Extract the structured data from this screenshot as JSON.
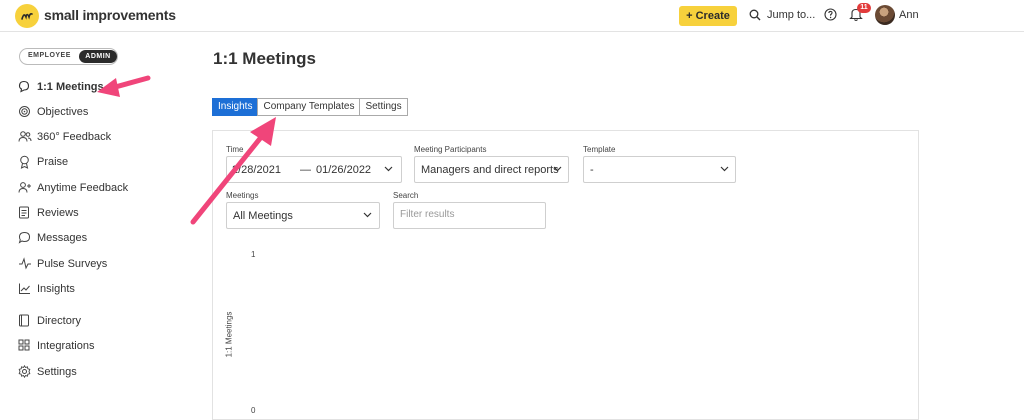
{
  "app": {
    "brand": "small improvements",
    "brand_color": "#f7d13c"
  },
  "topbar": {
    "create_label": "+ Create",
    "jump_label": "Jump to...",
    "notification_count": "11",
    "user_name": "Ann"
  },
  "mode_toggle": {
    "employee": "EMPLOYEE",
    "admin": "ADMIN",
    "active": "ADMIN"
  },
  "sidebar": {
    "items": [
      {
        "label": "1:1 Meetings",
        "icon": "chat-bubbles-icon",
        "active": true
      },
      {
        "label": "Objectives",
        "icon": "target-icon"
      },
      {
        "label": "360° Feedback",
        "icon": "people-icon"
      },
      {
        "label": "Praise",
        "icon": "ribbon-icon"
      },
      {
        "label": "Anytime Feedback",
        "icon": "person-plus-icon"
      },
      {
        "label": "Reviews",
        "icon": "document-icon"
      },
      {
        "label": "Messages",
        "icon": "message-icon"
      },
      {
        "label": "Pulse Surveys",
        "icon": "pulse-icon"
      },
      {
        "label": "Insights",
        "icon": "chart-icon"
      },
      {
        "label": "Directory",
        "icon": "book-icon"
      },
      {
        "label": "Integrations",
        "icon": "grid-icon"
      },
      {
        "label": "Settings",
        "icon": "gear-icon"
      }
    ]
  },
  "main": {
    "title": "1:1 Meetings",
    "tabs": [
      {
        "label": "Insights",
        "active": true
      },
      {
        "label": "Company Templates"
      },
      {
        "label": "Settings"
      }
    ],
    "filters": {
      "time_label": "Time",
      "time_start": "2/28/2021",
      "time_separator": "—",
      "time_end": "01/26/2022",
      "participants_label": "Meeting Participants",
      "participants_value": "Managers and direct reports",
      "template_label": "Template",
      "template_value": "-",
      "meetings_label": "Meetings",
      "meetings_value": "All Meetings",
      "search_label": "Search",
      "search_placeholder": "Filter results"
    },
    "chart": {
      "y_axis_label": "1:1 Meetings",
      "y_tick_top": "1",
      "y_tick_bottom": "0"
    }
  },
  "annotation_color": "#f0457a",
  "accent_color": "#1d6fd6"
}
